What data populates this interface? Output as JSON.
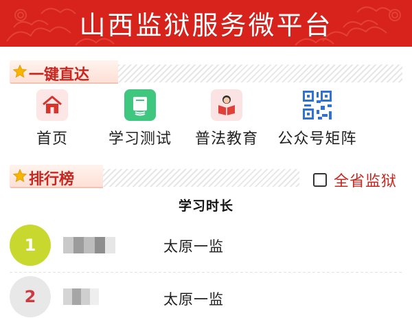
{
  "header": {
    "title": "山西监狱服务微平台"
  },
  "quick_section": {
    "title": "一键直达"
  },
  "quick_links": [
    {
      "label": "首页",
      "icon": "home-icon"
    },
    {
      "label": "学习测试",
      "icon": "book-icon"
    },
    {
      "label": "普法教育",
      "icon": "reading-person-icon"
    },
    {
      "label": "公众号矩阵",
      "icon": "qr-code-icon"
    }
  ],
  "ranking_section": {
    "title": "排行榜"
  },
  "province_filter": {
    "label": "全省监狱",
    "checked": false
  },
  "ranking": {
    "title": "学习时长",
    "rows": [
      {
        "rank": "1",
        "unit": "太原一监"
      },
      {
        "rank": "2",
        "unit": "太原一监"
      }
    ]
  },
  "colors": {
    "banner": "#d8231c",
    "accent": "#c8261f",
    "rank1": "#c8d82e",
    "rank2": "#e8e8e8"
  }
}
